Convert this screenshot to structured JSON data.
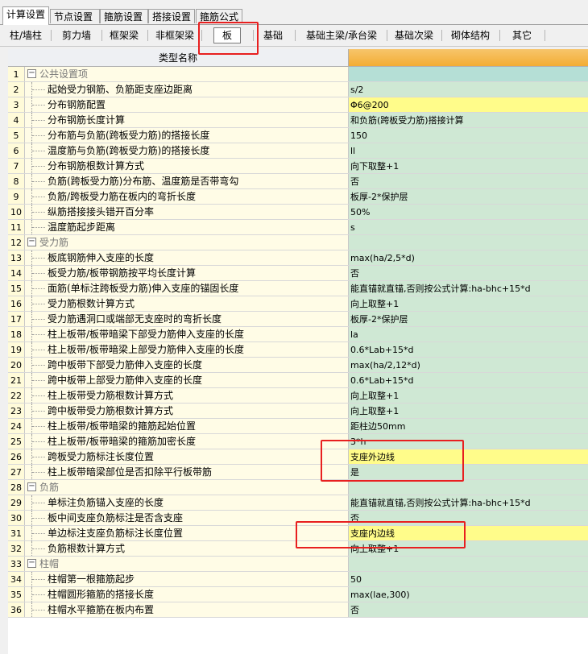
{
  "tabs": [
    {
      "label": "计算设置",
      "active": true
    },
    {
      "label": "节点设置",
      "active": false
    },
    {
      "label": "箍筋设置",
      "active": false
    },
    {
      "label": "搭接设置",
      "active": false
    },
    {
      "label": "箍筋公式",
      "active": false
    }
  ],
  "subtabs": [
    {
      "label": "柱/墙柱"
    },
    {
      "label": "剪力墙"
    },
    {
      "label": "框架梁"
    },
    {
      "label": "非框架梁"
    },
    {
      "label": "板",
      "selected": true
    },
    {
      "label": "基础"
    },
    {
      "label": "基础主梁/承台梁"
    },
    {
      "label": "基础次梁"
    },
    {
      "label": "砌体结构"
    },
    {
      "label": "其它"
    }
  ],
  "grid": {
    "header": {
      "name_col": "类型名称",
      "value_col": ""
    },
    "rows": [
      {
        "num": "1",
        "name": "公共设置项",
        "value": "",
        "group": true
      },
      {
        "num": "2",
        "name": "起始受力钢筋、负筋距支座边距离",
        "value": "s/2"
      },
      {
        "num": "3",
        "name": "分布钢筋配置",
        "value": "Φ6@200",
        "highlight": "yellow"
      },
      {
        "num": "4",
        "name": "分布钢筋长度计算",
        "value": "和负筋(跨板受力筋)搭接计算"
      },
      {
        "num": "5",
        "name": "分布筋与负筋(跨板受力筋)的搭接长度",
        "value": "150"
      },
      {
        "num": "6",
        "name": "温度筋与负筋(跨板受力筋)的搭接长度",
        "value": "ll"
      },
      {
        "num": "7",
        "name": "分布钢筋根数计算方式",
        "value": "向下取整+1"
      },
      {
        "num": "8",
        "name": "负筋(跨板受力筋)分布筋、温度筋是否带弯勾",
        "value": "否"
      },
      {
        "num": "9",
        "name": "负筋/跨板受力筋在板内的弯折长度",
        "value": "板厚-2*保护层"
      },
      {
        "num": "10",
        "name": "纵筋搭接接头错开百分率",
        "value": "50%"
      },
      {
        "num": "11",
        "name": "温度筋起步距离",
        "value": "s"
      },
      {
        "num": "12",
        "name": "受力筋",
        "value": "",
        "group": true
      },
      {
        "num": "13",
        "name": "板底钢筋伸入支座的长度",
        "value": "max(ha/2,5*d)"
      },
      {
        "num": "14",
        "name": "板受力筋/板带钢筋按平均长度计算",
        "value": "否"
      },
      {
        "num": "15",
        "name": "面筋(单标注跨板受力筋)伸入支座的锚固长度",
        "value": "能直锚就直锚,否则按公式计算:ha-bhc+15*d"
      },
      {
        "num": "16",
        "name": "受力筋根数计算方式",
        "value": "向上取整+1"
      },
      {
        "num": "17",
        "name": "受力筋遇洞口或端部无支座时的弯折长度",
        "value": "板厚-2*保护层"
      },
      {
        "num": "18",
        "name": "柱上板带/板带暗梁下部受力筋伸入支座的长度",
        "value": "la"
      },
      {
        "num": "19",
        "name": "柱上板带/板带暗梁上部受力筋伸入支座的长度",
        "value": "0.6*Lab+15*d"
      },
      {
        "num": "20",
        "name": "跨中板带下部受力筋伸入支座的长度",
        "value": "max(ha/2,12*d)"
      },
      {
        "num": "21",
        "name": "跨中板带上部受力筋伸入支座的长度",
        "value": "0.6*Lab+15*d"
      },
      {
        "num": "22",
        "name": "柱上板带受力筋根数计算方式",
        "value": "向上取整+1"
      },
      {
        "num": "23",
        "name": "跨中板带受力筋根数计算方式",
        "value": "向上取整+1"
      },
      {
        "num": "24",
        "name": "柱上板带/板带暗梁的箍筋起始位置",
        "value": "距柱边50mm"
      },
      {
        "num": "25",
        "name": "柱上板带/板带暗梁的箍筋加密长度",
        "value": "3*h"
      },
      {
        "num": "26",
        "name": "跨板受力筋标注长度位置",
        "value": "支座外边线",
        "highlight": "yellow"
      },
      {
        "num": "27",
        "name": "柱上板带暗梁部位是否扣除平行板带筋",
        "value": "是"
      },
      {
        "num": "28",
        "name": "负筋",
        "value": "",
        "group": true
      },
      {
        "num": "29",
        "name": "单标注负筋锚入支座的长度",
        "value": "能直锚就直锚,否则按公式计算:ha-bhc+15*d"
      },
      {
        "num": "30",
        "name": "板中间支座负筋标注是否含支座",
        "value": "否"
      },
      {
        "num": "31",
        "name": "单边标注支座负筋标注长度位置",
        "value": "支座内边线",
        "highlight": "yellow"
      },
      {
        "num": "32",
        "name": "负筋根数计算方式",
        "value": "向上取整+1"
      },
      {
        "num": "33",
        "name": "柱帽",
        "value": "",
        "group": true
      },
      {
        "num": "34",
        "name": "柱帽第一根箍筋起步",
        "value": "50"
      },
      {
        "num": "35",
        "name": "柱帽圆形箍筋的搭接长度",
        "value": "max(lae,300)"
      },
      {
        "num": "36",
        "name": "柱帽水平箍筋在板内布置",
        "value": "否"
      }
    ]
  },
  "colors": {
    "highlight_box": "#e81f1f",
    "value_green": "#cfe8d4",
    "value_yellow": "#fffc8a",
    "header_orange": "#f3ad34"
  }
}
